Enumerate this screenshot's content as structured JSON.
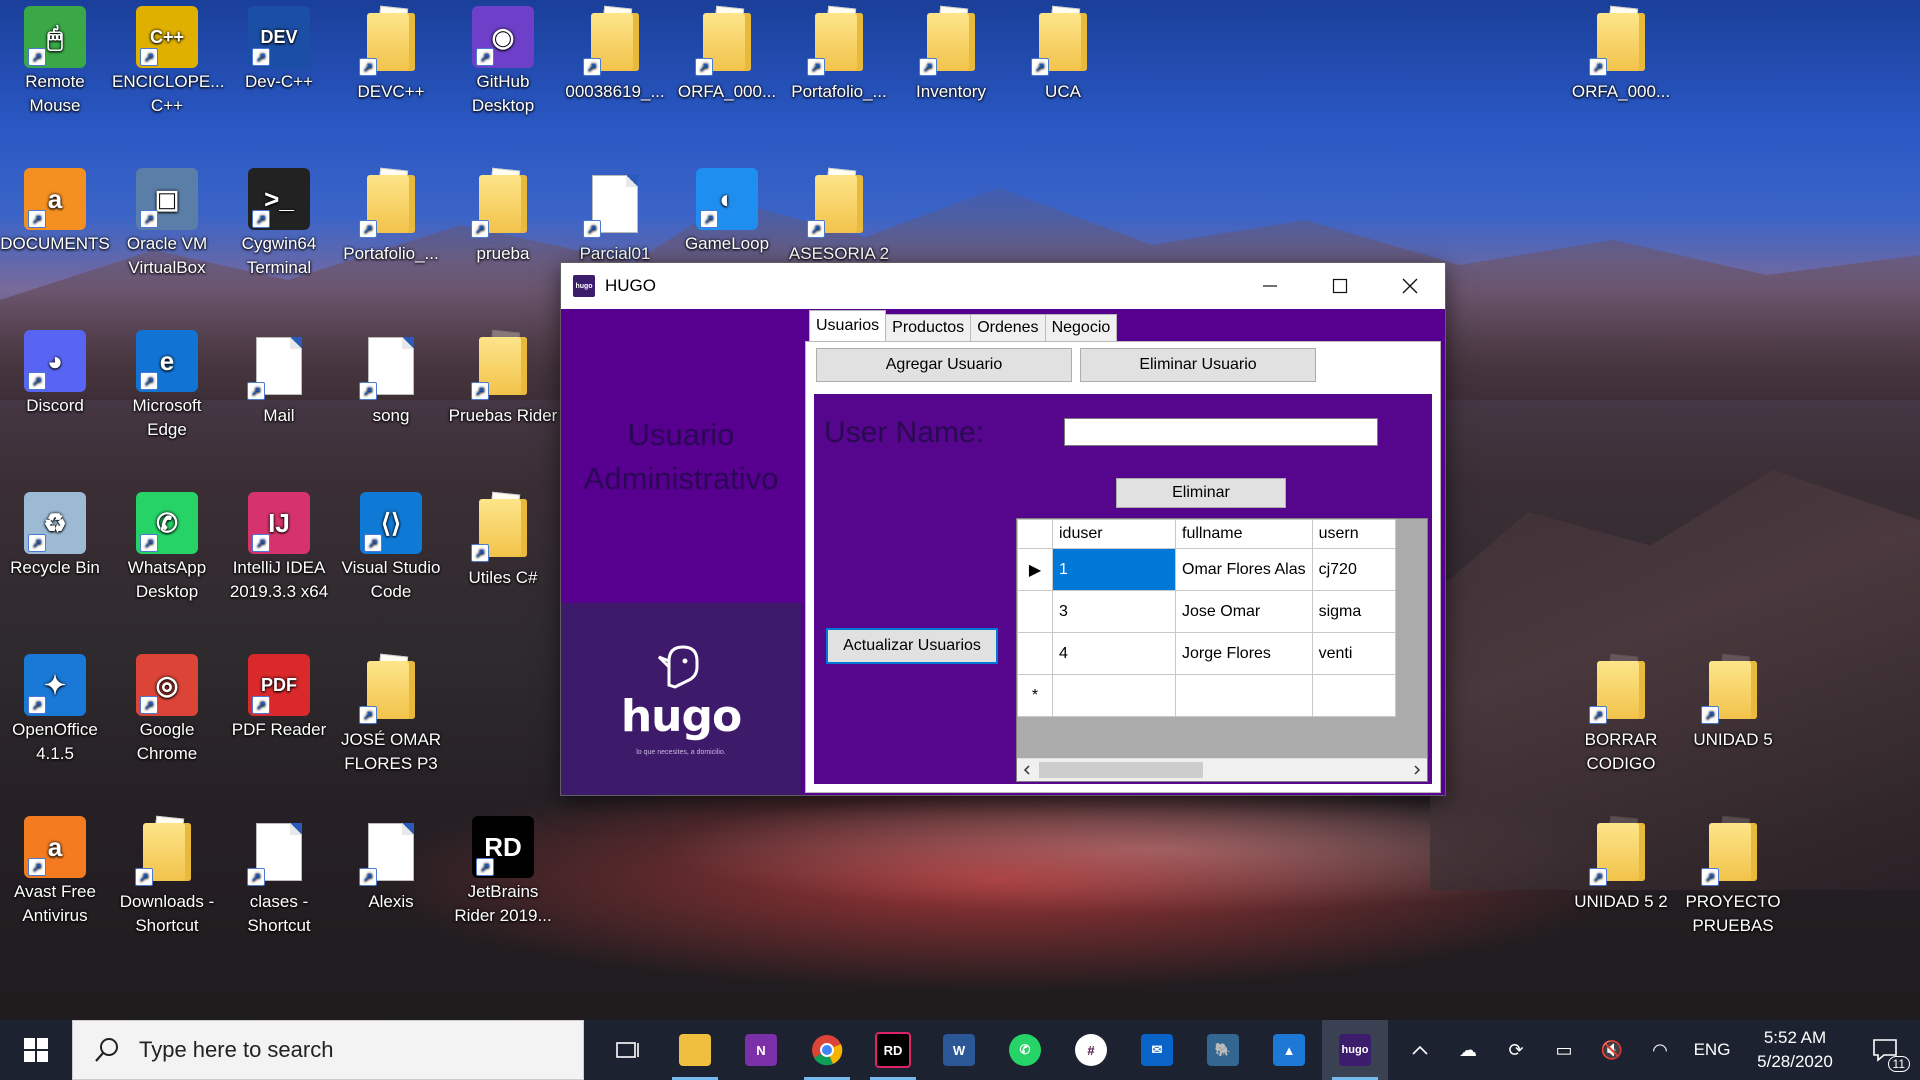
{
  "desktop": {
    "icons": [
      {
        "label": "Remote Mouse"
      },
      {
        "label": "ENCICLOPE... C++"
      },
      {
        "label": "Dev-C++"
      },
      {
        "label": "DEVC++"
      },
      {
        "label": "GitHub Desktop"
      },
      {
        "label": "00038619_..."
      },
      {
        "label": "ORFA_000..."
      },
      {
        "label": "Portafolio_..."
      },
      {
        "label": "Inventory"
      },
      {
        "label": "UCA"
      },
      {
        "label": "ORFA_000..."
      },
      {
        "label": "DOCUMENTS"
      },
      {
        "label": "Oracle VM VirtualBox"
      },
      {
        "label": "Cygwin64 Terminal"
      },
      {
        "label": "Portafolio_..."
      },
      {
        "label": "prueba"
      },
      {
        "label": "Parcial01"
      },
      {
        "label": "GameLoop"
      },
      {
        "label": "ASESORIA 2"
      },
      {
        "label": "Discord"
      },
      {
        "label": "Microsoft Edge"
      },
      {
        "label": "Mail"
      },
      {
        "label": "song"
      },
      {
        "label": "Pruebas Rider"
      },
      {
        "label": "Recycle Bin"
      },
      {
        "label": "WhatsApp Desktop"
      },
      {
        "label": "IntelliJ IDEA 2019.3.3 x64"
      },
      {
        "label": "Visual Studio Code"
      },
      {
        "label": "Utiles C#"
      },
      {
        "label": "OpenOffice 4.1.5"
      },
      {
        "label": "Google Chrome"
      },
      {
        "label": "PDF Reader"
      },
      {
        "label": "JOSÉ OMAR FLORES P3"
      },
      {
        "label": "BORRAR CODIGO"
      },
      {
        "label": "UNIDAD 5"
      },
      {
        "label": "Avast Free Antivirus"
      },
      {
        "label": "Downloads - Shortcut"
      },
      {
        "label": "clases - Shortcut"
      },
      {
        "label": "Alexis"
      },
      {
        "label": "JetBrains Rider 2019..."
      },
      {
        "label": "UNIDAD 5 2"
      },
      {
        "label": "PROYECTO PRUEBAS"
      }
    ]
  },
  "window": {
    "title": "HUGO",
    "left_panel": {
      "heading": "Usuario Administrativo",
      "brand": "hugo",
      "tagline": "lo que necesites, a domicilio."
    },
    "tabs": [
      {
        "label": "Usuarios",
        "active": true
      },
      {
        "label": "Productos"
      },
      {
        "label": "Ordenes"
      },
      {
        "label": "Negocio"
      }
    ],
    "buttons": {
      "add_user": "Agregar Usuario",
      "delete_user": "Eliminar Usuario",
      "delete": "Eliminar",
      "refresh": "Actualizar Usuarios"
    },
    "form": {
      "username_label": "User Name:",
      "username_value": ""
    },
    "grid": {
      "columns": [
        "iduser",
        "fullname",
        "usern"
      ],
      "rows": [
        {
          "iduser": "1",
          "fullname": "Omar Flores Alas",
          "username": "cj720"
        },
        {
          "iduser": "3",
          "fullname": "Jose Omar",
          "username": "sigma"
        },
        {
          "iduser": "4",
          "fullname": "Jorge Flores",
          "username": "venti"
        }
      ],
      "new_row_marker": "*",
      "current_row_marker": "▶"
    }
  },
  "taskbar": {
    "search_placeholder": "Type here to search",
    "apps": [
      "task-view",
      "file-explorer",
      "onenote",
      "chrome",
      "rider",
      "word",
      "whatsapp",
      "slack",
      "mail",
      "pgadmin",
      "photos",
      "hugo"
    ],
    "hugo_label": "hugo",
    "tray": {
      "language": "ENG",
      "time": "5:52 AM",
      "date": "5/28/2020",
      "notifications": "11"
    }
  }
}
